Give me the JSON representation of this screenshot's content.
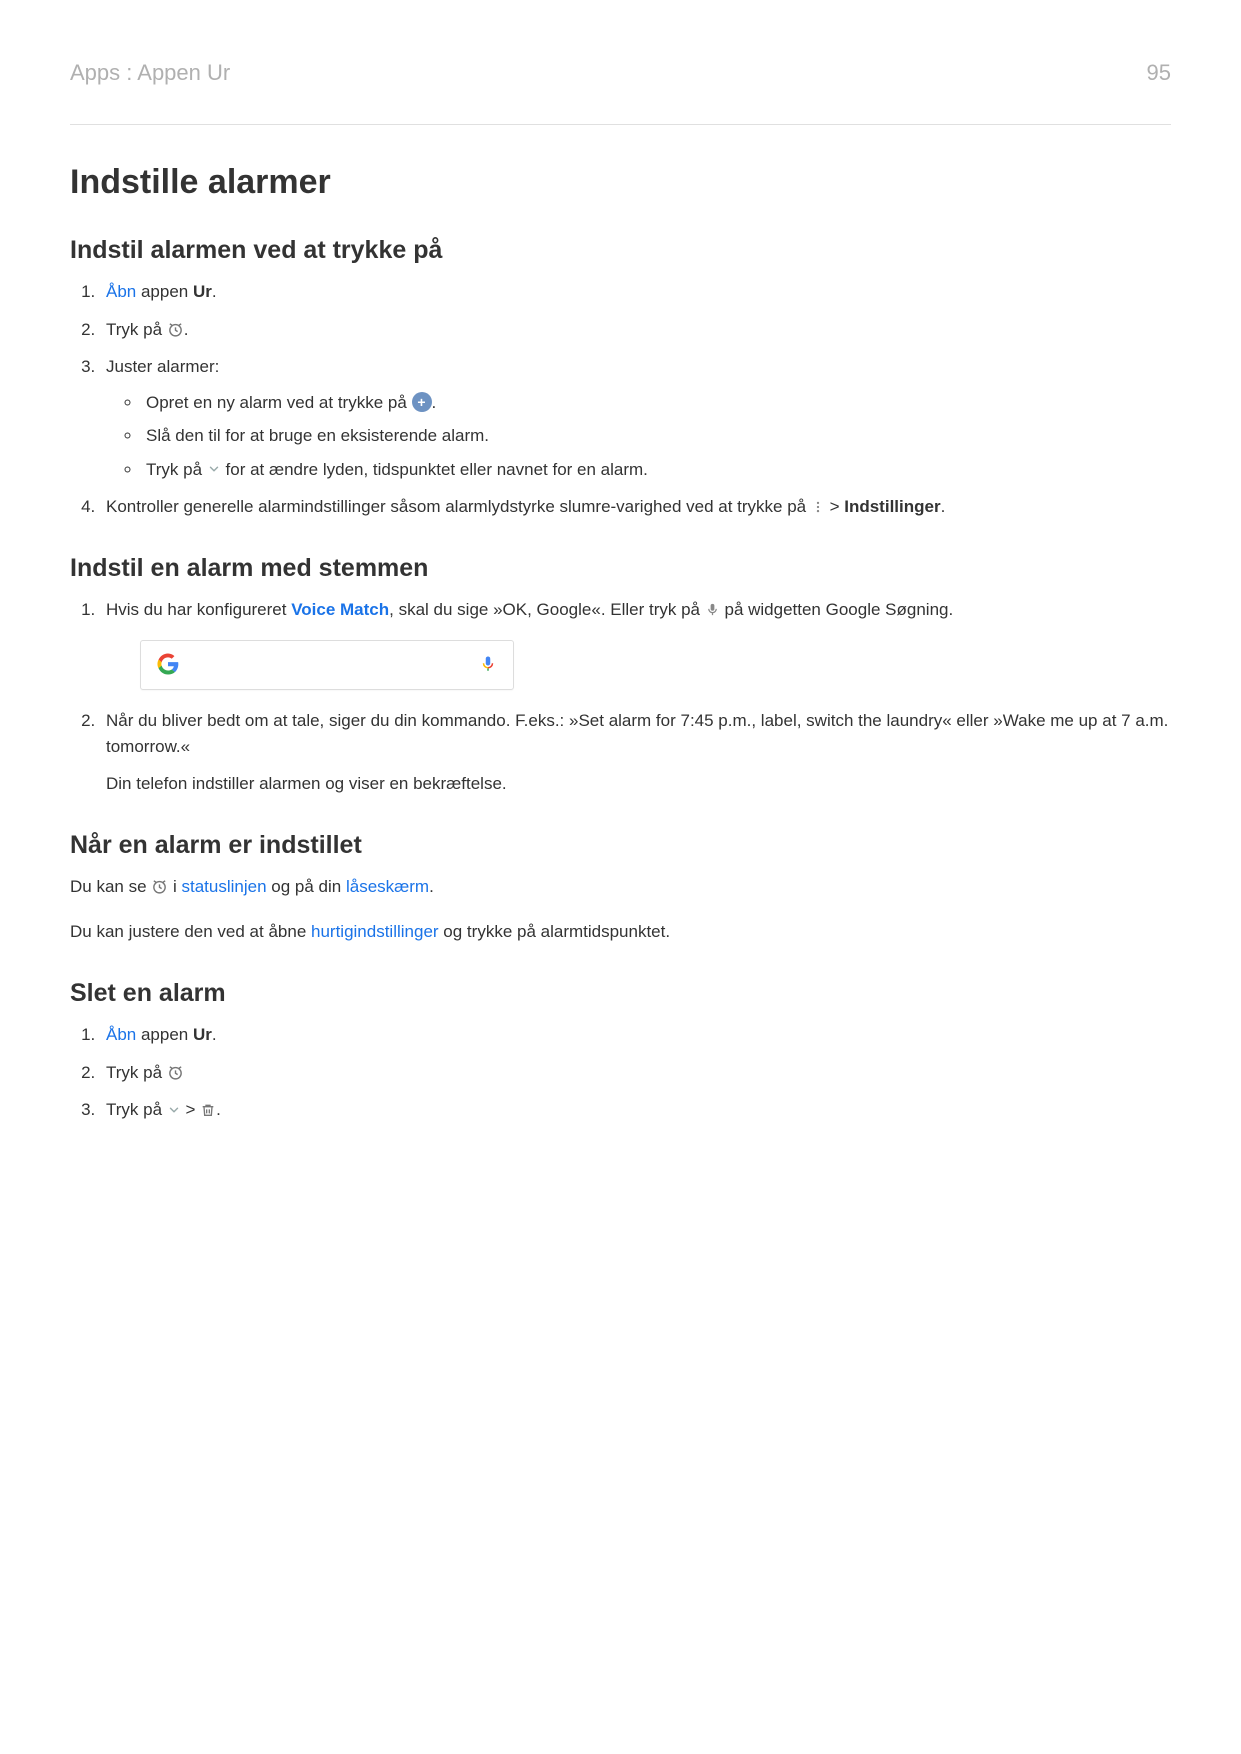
{
  "header": {
    "breadcrumb": "Apps : Appen Ur",
    "page_number": "95"
  },
  "h1": "Indstille alarmer",
  "sectionA": {
    "title": "Indstil alarmen ved at trykke på",
    "step1": {
      "link": "Åbn",
      "mid": " appen ",
      "bold": "Ur",
      "tail": "."
    },
    "step2_pre": "Tryk på ",
    "step2_post": ".",
    "step3_intro": "Juster alarmer:",
    "step3_b1_pre": "Opret en ny alarm ved at trykke på ",
    "step3_b1_post": ".",
    "step3_b2": "Slå den til for at bruge en eksisterende alarm.",
    "step3_b3_pre": "Tryk på ",
    "step3_b3_post": " for at ændre lyden, tidspunktet eller navnet for en alarm.",
    "step4_pre": "Kontroller generelle alarmindstillinger såsom alarmlydstyrke slumre-varighed ved at trykke på ",
    "step4_gt": " > ",
    "step4_bold": "Indstillinger",
    "step4_post": "."
  },
  "sectionB": {
    "title": "Indstil en alarm med stemmen",
    "step1_pre": "Hvis du har konfigureret ",
    "step1_link": "Voice Match",
    "step1_mid": ", skal du sige »OK, Google«. Eller tryk på ",
    "step1_post": " på widgetten Google Søgning.",
    "step2": "Når du bliver bedt om at tale, siger du din kommando. F.eks.: »Set alarm for 7:45 p.m., label, switch the laundry« eller »Wake me up at 7 a.m. tomorrow.«",
    "step2_after": "Din telefon indstiller alarmen og viser en bekræftelse."
  },
  "sectionC": {
    "title": "Når en alarm er indstillet",
    "p1_pre": "Du kan se ",
    "p1_mid1": " i ",
    "p1_link1": "statuslinjen",
    "p1_mid2": " og på din ",
    "p1_link2": "låseskærm",
    "p1_post": ".",
    "p2_pre": "Du kan justere den ved at åbne ",
    "p2_link": "hurtigindstillinger",
    "p2_post": " og trykke på alarmtidspunktet."
  },
  "sectionD": {
    "title": "Slet en alarm",
    "step1": {
      "link": "Åbn",
      "mid": " appen ",
      "bold": "Ur",
      "tail": "."
    },
    "step2_pre": "Tryk på ",
    "step3_pre": "Tryk på ",
    "step3_mid": " > ",
    "step3_post": "."
  }
}
